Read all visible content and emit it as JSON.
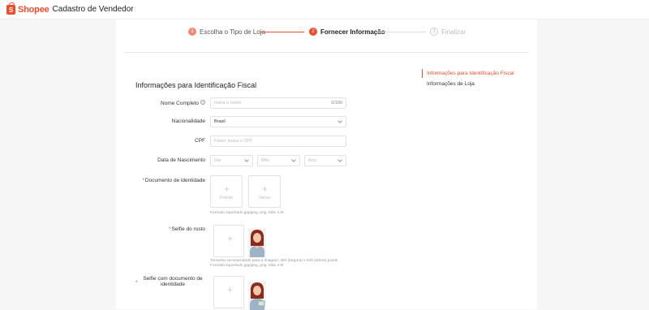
{
  "header": {
    "logo_text": "Shopee",
    "title": "Cadastro de Vendedor",
    "logo_glyph": "S"
  },
  "steps": [
    {
      "num": "1",
      "label": "Escolha o Tipo de Loja",
      "state": "done"
    },
    {
      "num": "2",
      "label": "Fornecer Informação",
      "state": "active"
    },
    {
      "num": "3",
      "label": "Finalizar",
      "state": "pending"
    }
  ],
  "form": {
    "section_title": "Informações para Identificação Fiscal",
    "full_name": {
      "label": "Nome Completo",
      "help_icon": "?",
      "placeholder": "Insira o nome",
      "counter": "0/100"
    },
    "nationality": {
      "label": "Nacionalidade",
      "value": "Brasil"
    },
    "cpf": {
      "label": "CPF",
      "placeholder": "Favor, insira o CPF"
    },
    "birth_date": {
      "label": "Data de Nascimento",
      "day": "Dia",
      "month": "Mês",
      "year": "Ano"
    },
    "id_document": {
      "label": "Documento de identidade",
      "front": "Frente",
      "back": "Verso",
      "hint": "Formato suportado jpg/jpeg, png, Máx 4 M"
    },
    "selfie": {
      "label": "Selfie do rosto",
      "hint_line1": "Tamanho recomendado para a imagem: 480 (largura) x 640 (altura) pixels.",
      "hint_line2": "Formato suportado jpg/jpeg, png, Máx 4 M"
    },
    "selfie_doc": {
      "label_line1": "Selfie com documento de",
      "label_line2": "identidade"
    },
    "required_mark": "*",
    "plus": "+"
  },
  "sidebar": {
    "items": [
      {
        "label": "Informações para Identificação Fiscal",
        "active": true
      },
      {
        "label": "Informações de Loja",
        "active": false
      }
    ]
  },
  "colors": {
    "brand": "#ee4d2d",
    "accent_light": "#f08a77"
  }
}
